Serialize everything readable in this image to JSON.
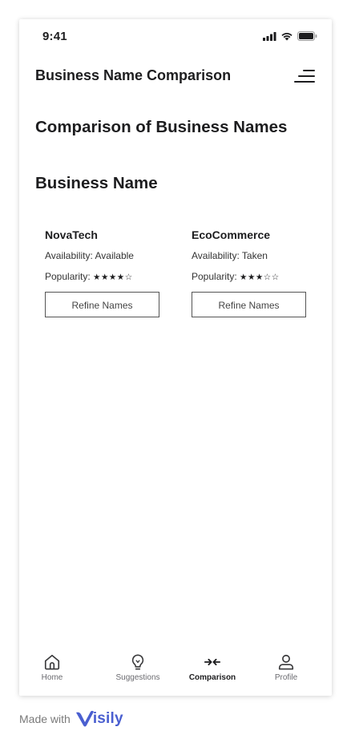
{
  "status_bar": {
    "time": "9:41"
  },
  "header": {
    "title": "Business Name Comparison",
    "menu_icon": "menu-lines-icon"
  },
  "page": {
    "title": "Comparison of Business Names",
    "section_title": "Business Name"
  },
  "cards": [
    {
      "name": "NovaTech",
      "availability": "Availability: Available",
      "popularity_label": "Popularity:",
      "stars": "★★★★☆",
      "rating": 4,
      "button_label": "Refine Names"
    },
    {
      "name": "EcoCommerce",
      "availability": "Availability: Taken",
      "popularity_label": "Popularity:",
      "stars": "★★★☆☆",
      "rating": 3,
      "button_label": "Refine Names"
    }
  ],
  "tabbar": {
    "items": [
      {
        "label": "Home",
        "icon": "home-icon",
        "active": false
      },
      {
        "label": "Suggestions",
        "icon": "lightbulb-icon",
        "active": false
      },
      {
        "label": "Comparison",
        "icon": "compare-arrows-icon",
        "active": true
      },
      {
        "label": "Profile",
        "icon": "user-icon",
        "active": false
      }
    ]
  },
  "footer": {
    "made_with": "Made with",
    "brand": "isily"
  },
  "colors": {
    "text": "#1d1d1f",
    "muted": "#6b6b70",
    "brand": "#4a5fd0",
    "border": "#555555"
  }
}
